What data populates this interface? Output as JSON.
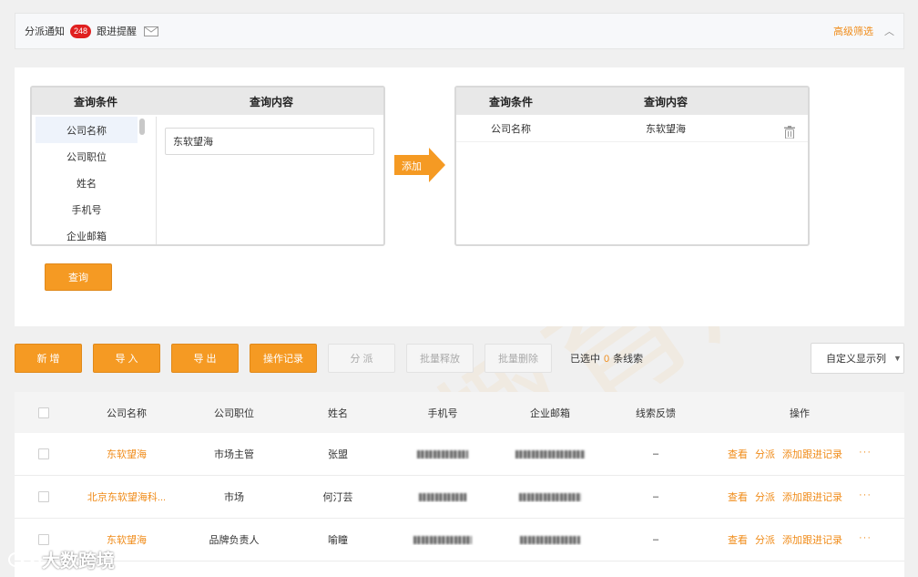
{
  "topbar": {
    "dispatch_label": "分派通知",
    "dispatch_count": "248",
    "followup_label": "跟进提醒",
    "advanced_filter": "高级筛选",
    "collapse_icon": "chevron-up-icon"
  },
  "query": {
    "left": {
      "header_condition": "查询条件",
      "header_content": "查询内容",
      "conditions": [
        "公司名称",
        "公司职位",
        "姓名",
        "手机号",
        "企业邮箱"
      ],
      "selected_index": 0,
      "input_value": "东软望海"
    },
    "add_label": "添加",
    "right": {
      "header_condition": "查询条件",
      "header_content": "查询内容",
      "rows": [
        {
          "condition": "公司名称",
          "content": "东软望海"
        }
      ]
    },
    "submit_label": "查询"
  },
  "toolbar": {
    "new_label": "新 增",
    "import_label": "导 入",
    "export_label": "导 出",
    "oplog_label": "操作记录",
    "dispatch_label": "分 派",
    "batch_release_label": "批量释放",
    "batch_delete_label": "批量删除",
    "selected_prefix": "已选中",
    "selected_count": "0",
    "selected_suffix": "条线索",
    "custom_columns_label": "自定义显示列"
  },
  "table": {
    "headers": [
      "公司名称",
      "公司职位",
      "姓名",
      "手机号",
      "企业邮箱",
      "线索反馈",
      "操作"
    ],
    "rows": [
      {
        "company": "东软望海",
        "position": "市场主管",
        "name": "张盟",
        "feedback": "–"
      },
      {
        "company": "北京东软望海科...",
        "position": "市场",
        "name": "何汀芸",
        "feedback": "–"
      },
      {
        "company": "东软望海",
        "position": "品牌负责人",
        "name": "喻瞳",
        "feedback": "–"
      }
    ],
    "actions": {
      "view": "查看",
      "dispatch": "分派",
      "add_record": "添加跟进记录",
      "more": "···"
    }
  },
  "watermark_text": "软趣育川",
  "logo_text": "大数跨境",
  "colors": {
    "accent": "#f59a23",
    "badge": "#e02020",
    "link": "#f08c1a"
  }
}
